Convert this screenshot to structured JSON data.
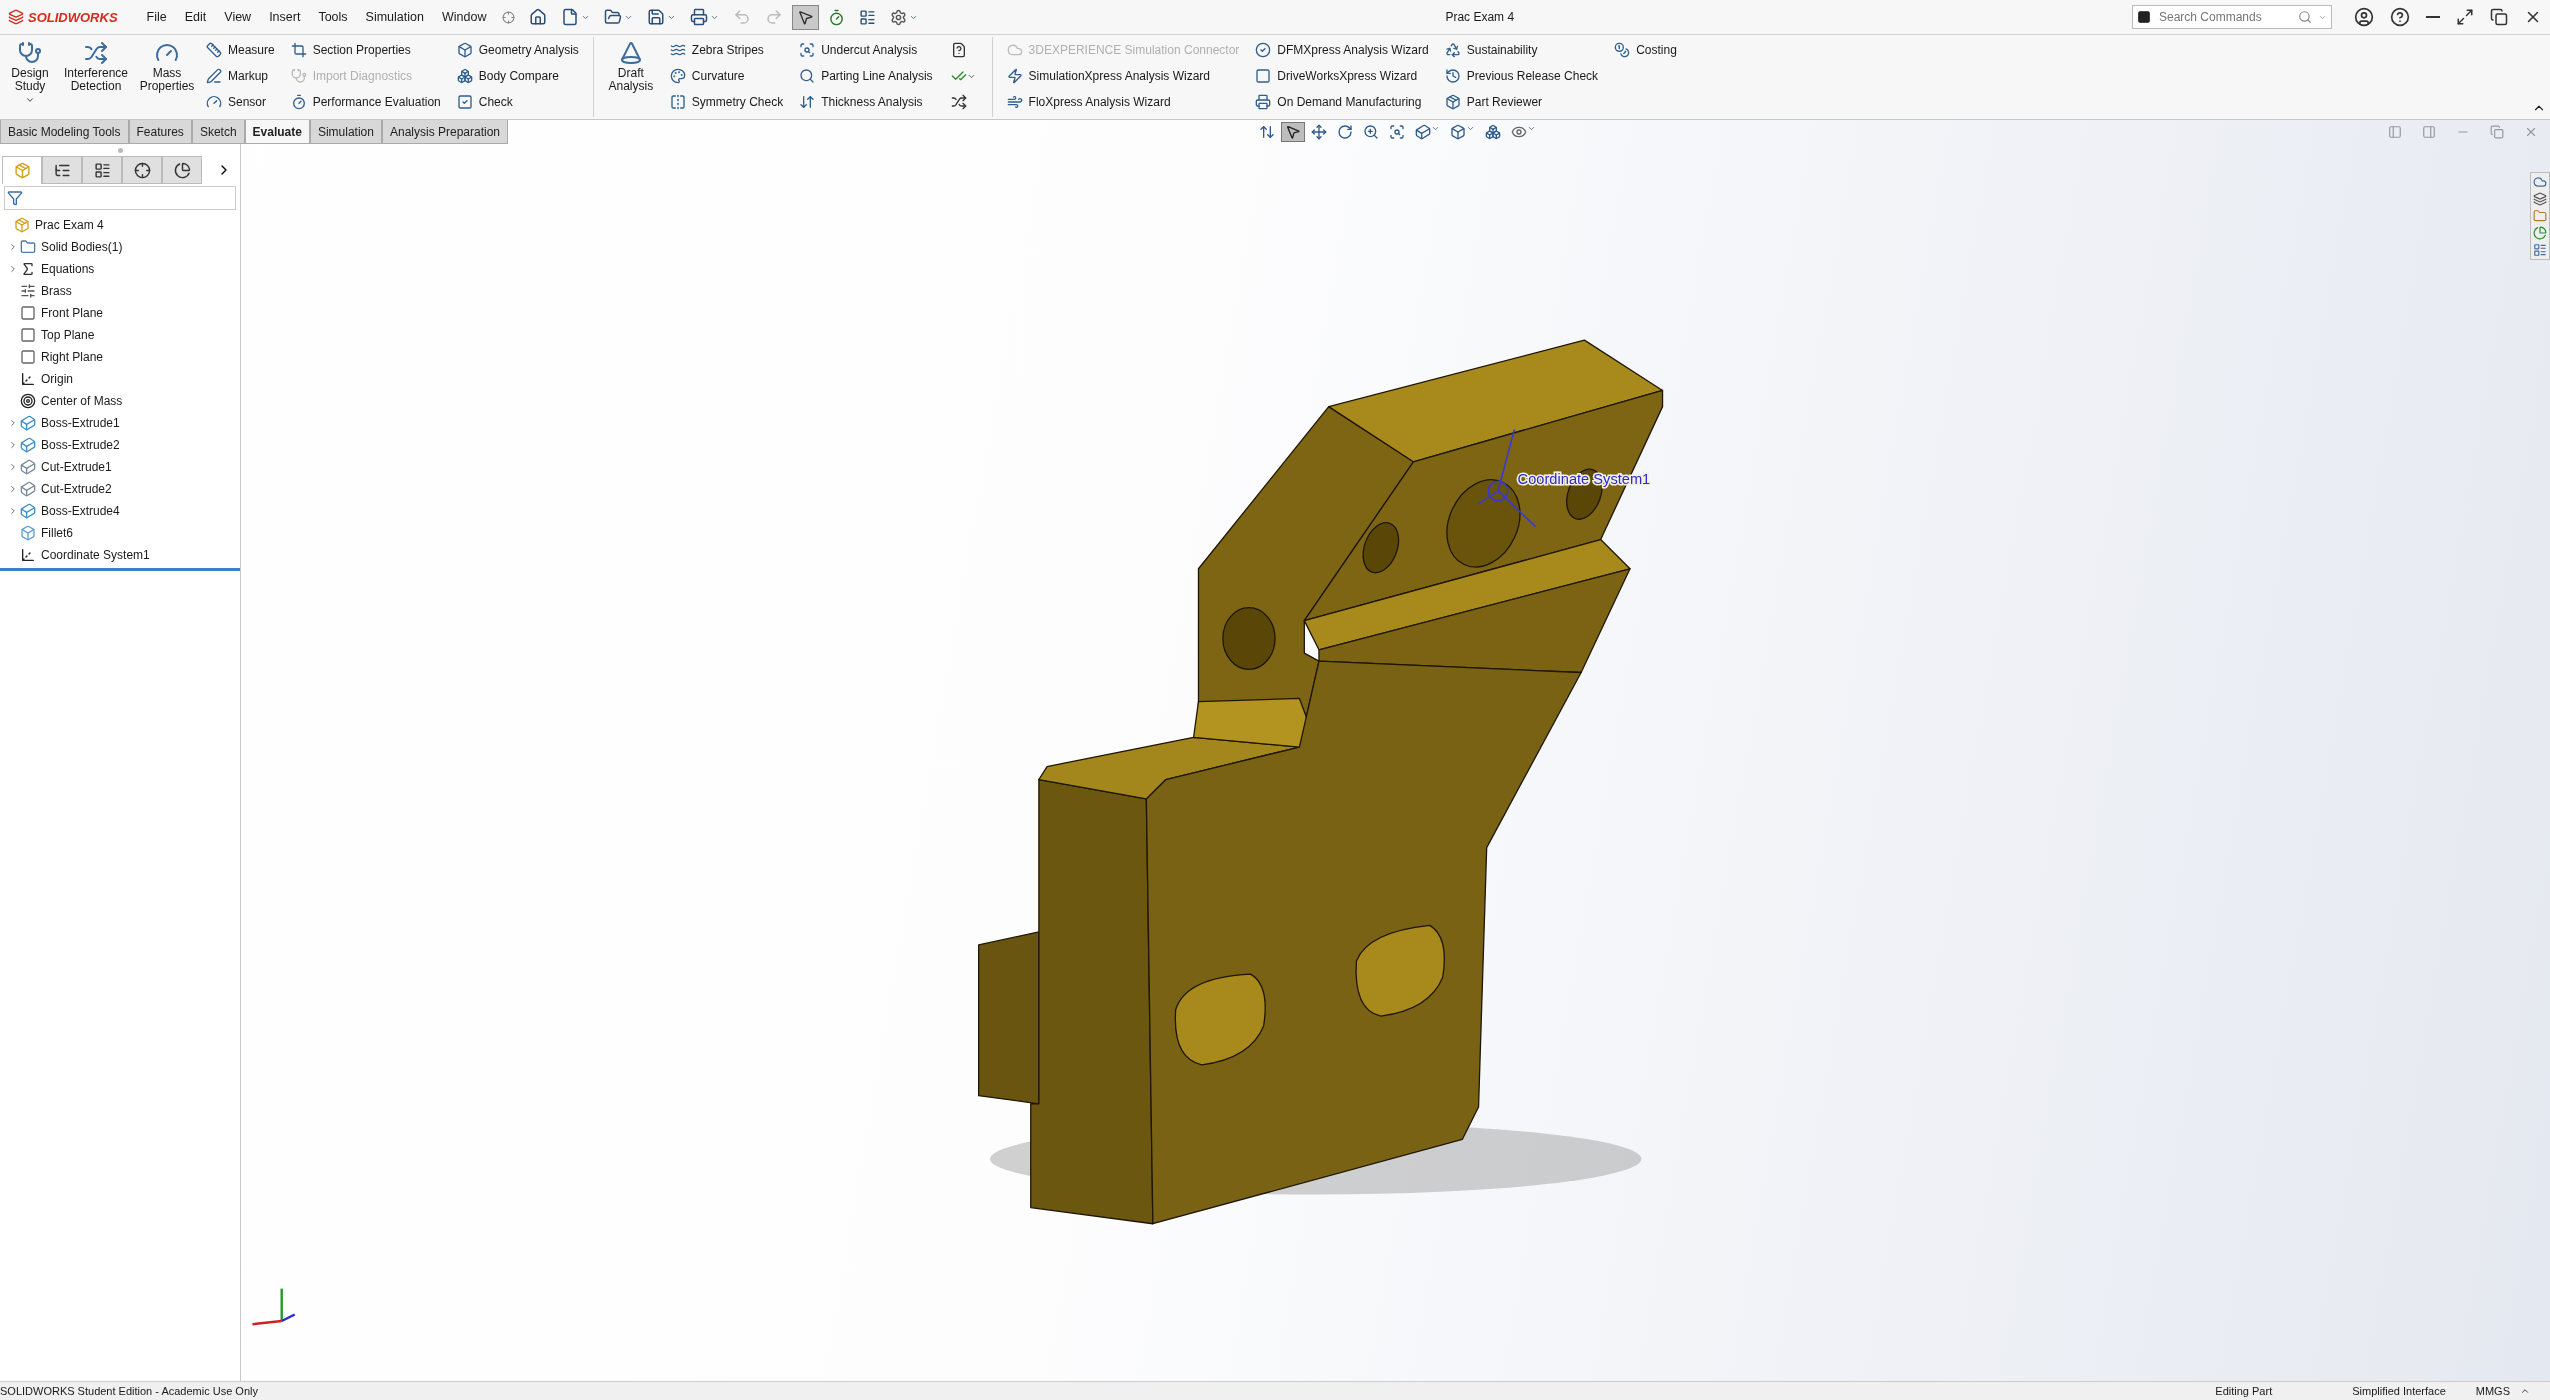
{
  "app": {
    "logo": "SOLIDWORKS"
  },
  "menu": [
    "File",
    "Edit",
    "View",
    "Insert",
    "Tools",
    "Simulation",
    "Window"
  ],
  "document_title": "Prac Exam 4",
  "search": {
    "placeholder": "Search Commands"
  },
  "ribbon": {
    "groups": [
      {
        "kind": "large",
        "items": [
          {
            "label": "Design Study",
            "dropdown": true,
            "disabled": false
          },
          {
            "label": "Interference Detection",
            "dropdown": false,
            "disabled": false
          },
          {
            "label": "Mass Properties",
            "dropdown": false,
            "disabled": false
          }
        ]
      },
      {
        "kind": "small",
        "items": [
          {
            "label": "Measure",
            "disabled": false
          },
          {
            "label": "Markup",
            "disabled": false
          },
          {
            "label": "Sensor",
            "disabled": false
          }
        ]
      },
      {
        "kind": "small",
        "items": [
          {
            "label": "Section Properties",
            "disabled": false
          },
          {
            "label": "Import Diagnostics",
            "disabled": true
          },
          {
            "label": "Performance Evaluation",
            "disabled": false
          }
        ]
      },
      {
        "kind": "small",
        "items": [
          {
            "label": "Geometry Analysis",
            "disabled": false
          },
          {
            "label": "Body Compare",
            "disabled": false
          },
          {
            "label": "Check",
            "disabled": false
          }
        ]
      },
      {
        "kind": "separator"
      },
      {
        "kind": "large",
        "items": [
          {
            "label": "Draft Analysis",
            "dropdown": false,
            "disabled": false
          }
        ]
      },
      {
        "kind": "small",
        "items": [
          {
            "label": "Zebra Stripes",
            "disabled": false
          },
          {
            "label": "Curvature",
            "disabled": false
          },
          {
            "label": "Symmetry Check",
            "disabled": false
          }
        ]
      },
      {
        "kind": "small",
        "items": [
          {
            "label": "Undercut Analysis",
            "disabled": false
          },
          {
            "label": "Parting Line Analysis",
            "disabled": false
          },
          {
            "label": "Thickness Analysis",
            "disabled": false
          }
        ]
      },
      {
        "kind": "icons"
      },
      {
        "kind": "separator"
      },
      {
        "kind": "small",
        "items": [
          {
            "label": "3DEXPERIENCE Simulation Connector",
            "disabled": true
          },
          {
            "label": "SimulationXpress Analysis Wizard",
            "disabled": false
          },
          {
            "label": "FloXpress Analysis Wizard",
            "disabled": false
          }
        ]
      },
      {
        "kind": "small",
        "items": [
          {
            "label": "DFMXpress Analysis Wizard",
            "disabled": false
          },
          {
            "label": "DriveWorksXpress Wizard",
            "disabled": false
          },
          {
            "label": "On Demand Manufacturing",
            "disabled": false
          }
        ]
      },
      {
        "kind": "small",
        "items": [
          {
            "label": "Sustainability",
            "disabled": false
          },
          {
            "label": "Previous Release Check",
            "disabled": false
          },
          {
            "label": "Part Reviewer",
            "disabled": false
          }
        ]
      },
      {
        "kind": "small",
        "items": [
          {
            "label": "Costing",
            "disabled": false
          }
        ]
      }
    ]
  },
  "command_tabs": [
    {
      "label": "Basic Modeling Tools",
      "selected": false
    },
    {
      "label": "Features",
      "selected": false
    },
    {
      "label": "Sketch",
      "selected": false
    },
    {
      "label": "Evaluate",
      "selected": true
    },
    {
      "label": "Simulation",
      "selected": false
    },
    {
      "label": "Analysis Preparation",
      "selected": false
    }
  ],
  "sidebar": {
    "tabs": [
      {
        "selected": true
      },
      {
        "selected": false
      },
      {
        "selected": false
      },
      {
        "selected": false
      },
      {
        "selected": false
      }
    ],
    "tree": [
      {
        "label": "Prac Exam 4",
        "kind": "part",
        "expandable": false
      },
      {
        "label": "Solid Bodies(1)",
        "kind": "bodies",
        "expandable": true
      },
      {
        "label": "Equations",
        "kind": "equations",
        "expandable": true
      },
      {
        "label": "Brass",
        "kind": "material",
        "expandable": false
      },
      {
        "label": "Front Plane",
        "kind": "plane",
        "expandable": false
      },
      {
        "label": "Top Plane",
        "kind": "plane",
        "expandable": false
      },
      {
        "label": "Right Plane",
        "kind": "plane",
        "expandable": false
      },
      {
        "label": "Origin",
        "kind": "origin",
        "expandable": false
      },
      {
        "label": "Center of Mass",
        "kind": "mass",
        "expandable": false
      },
      {
        "label": "Boss-Extrude1",
        "kind": "boss",
        "expandable": true
      },
      {
        "label": "Boss-Extrude2",
        "kind": "boss",
        "expandable": true
      },
      {
        "label": "Cut-Extrude1",
        "kind": "cut",
        "expandable": true
      },
      {
        "label": "Cut-Extrude2",
        "kind": "cut",
        "expandable": true
      },
      {
        "label": "Boss-Extrude4",
        "kind": "boss",
        "expandable": true
      },
      {
        "label": "Fillet6",
        "kind": "fillet",
        "expandable": false
      },
      {
        "label": "Coordinate System1",
        "kind": "coordinates",
        "expandable": false
      }
    ]
  },
  "viewport": {
    "annotation": "Coordinate System1"
  },
  "status_bar": {
    "edition": "SOLIDWORKS Student Edition - Academic Use Only",
    "mode": "Editing Part",
    "interface": "Simplified Interface",
    "units": "MMGS"
  }
}
